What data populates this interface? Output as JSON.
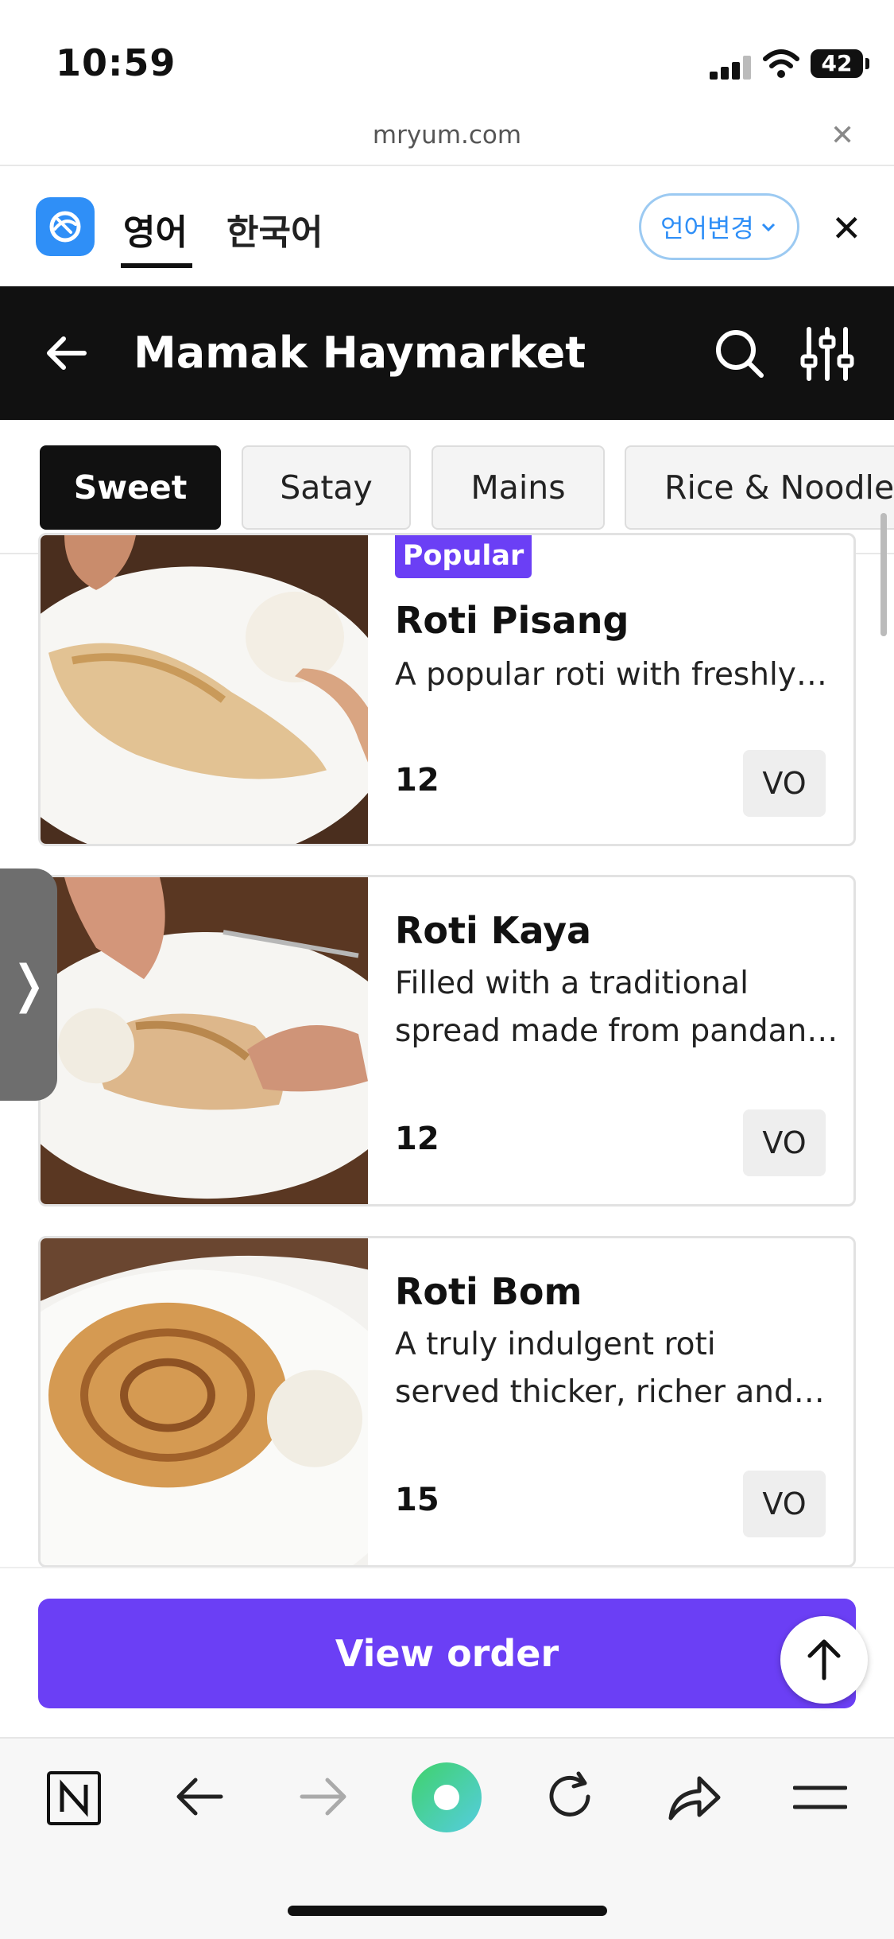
{
  "status_bar": {
    "time": "10:59",
    "battery": "42"
  },
  "browser": {
    "url": "mryum.com",
    "close_icon": "close-icon"
  },
  "translate_bar": {
    "lang_active": "영어",
    "lang_other": "한국어",
    "change_language": "언어변경",
    "colors": {
      "accent": "#2f8ff7"
    }
  },
  "header": {
    "title": "Mamak Haymarket"
  },
  "categories": [
    {
      "label": "Sweet",
      "active": true
    },
    {
      "label": "Satay",
      "active": false
    },
    {
      "label": "Mains",
      "active": false
    },
    {
      "label": "Rice & Noodles",
      "active": false
    }
  ],
  "items": [
    {
      "badge": "Popular",
      "name": "Roti Pisang",
      "desc": "A popular roti with freshly…",
      "price": "12",
      "tag": "VO"
    },
    {
      "name": "Roti Kaya",
      "desc_line1": "Filled with a traditional",
      "desc_line2": "spread made from pandan…",
      "price": "12",
      "tag": "VO"
    },
    {
      "name": "Roti Bom",
      "desc_line1": "A truly indulgent roti",
      "desc_line2": "served thicker, richer and…",
      "price": "15",
      "tag": "VO"
    }
  ],
  "footer": {
    "view_order": "View order",
    "colors": {
      "primary": "#6b3ff5"
    }
  },
  "side_tab_glyph": "❭"
}
